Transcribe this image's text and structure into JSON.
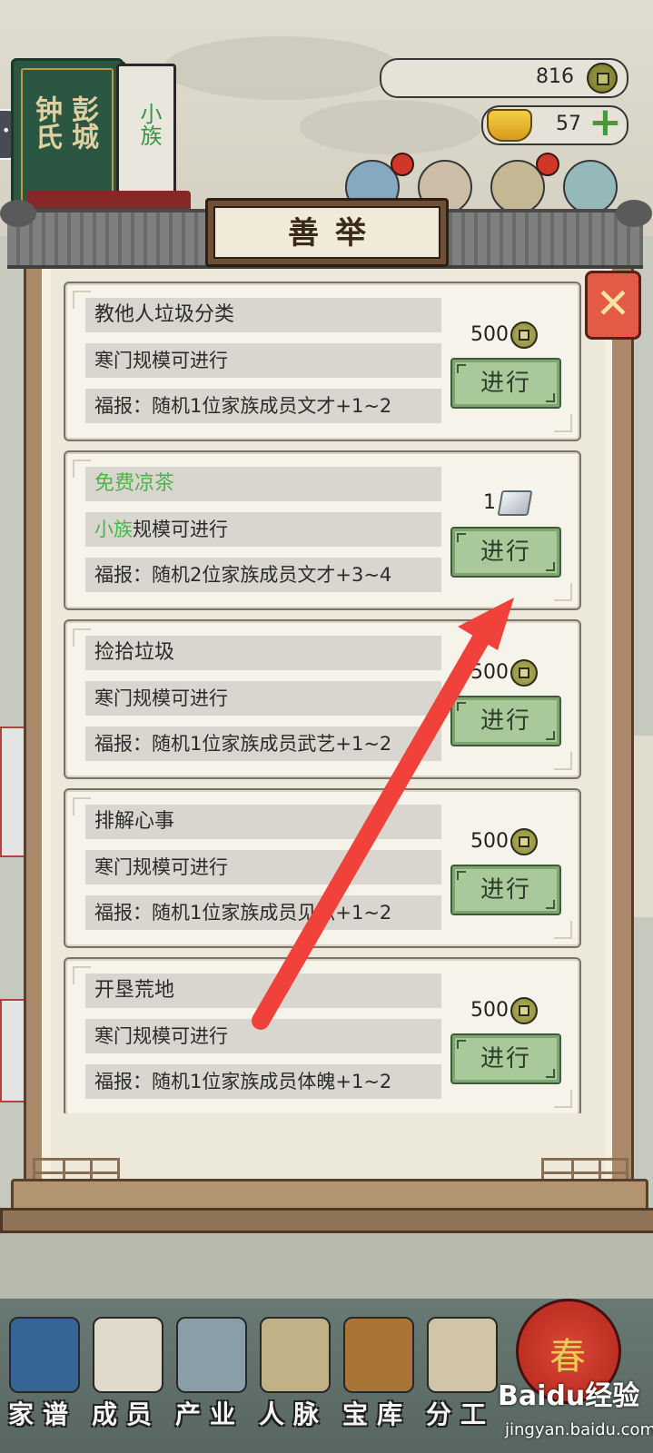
{
  "clan": {
    "surname_left": "彭城",
    "surname_right": "钟氏",
    "rank": "小族"
  },
  "resources": {
    "coins": "816",
    "gold": "57"
  },
  "dialog": {
    "title": "善举",
    "deeds": [
      {
        "name": "教他人垃圾分类",
        "name_highlight": false,
        "requirement_prefix": "",
        "requirement": "寒门规模可进行",
        "reward": "福报：随机1位家族成员文才+1~2",
        "cost": "500",
        "cost_icon": "copper-coin-icon",
        "action": "进行"
      },
      {
        "name": "免费凉茶",
        "name_highlight": true,
        "requirement_prefix": "小族",
        "requirement": "规模可进行",
        "reward": "福报：随机2位家族成员文才+3~4",
        "cost": "1",
        "cost_icon": "silver-ingot-icon",
        "action": "进行"
      },
      {
        "name": "捡拾垃圾",
        "name_highlight": false,
        "requirement_prefix": "",
        "requirement": "寒门规模可进行",
        "reward": "福报：随机1位家族成员武艺+1~2",
        "cost": "500",
        "cost_icon": "copper-coin-icon",
        "action": "进行"
      },
      {
        "name": "排解心事",
        "name_highlight": false,
        "requirement_prefix": "",
        "requirement": "寒门规模可进行",
        "reward": "福报：随机1位家族成员见识+1~2",
        "cost": "500",
        "cost_icon": "copper-coin-icon",
        "action": "进行"
      },
      {
        "name": "开垦荒地",
        "name_highlight": false,
        "requirement_prefix": "",
        "requirement": "寒门规模可进行",
        "reward": "福报：随机1位家族成员体魄+1~2",
        "cost": "500",
        "cost_icon": "copper-coin-icon",
        "action": "进行"
      }
    ]
  },
  "bottom_nav": [
    {
      "label": "家谱"
    },
    {
      "label": "成员"
    },
    {
      "label": "产业"
    },
    {
      "label": "人脉"
    },
    {
      "label": "宝库"
    },
    {
      "label": "分工"
    }
  ],
  "festival_badge": "春",
  "watermark": {
    "logo": "Baidu经验",
    "url": "jingyan.baidu.com"
  },
  "colors": {
    "accent_green": "#4fb34a",
    "button_green": "#a9c99a",
    "close_red": "#e35a47",
    "annotation_arrow": "#f0423a"
  }
}
